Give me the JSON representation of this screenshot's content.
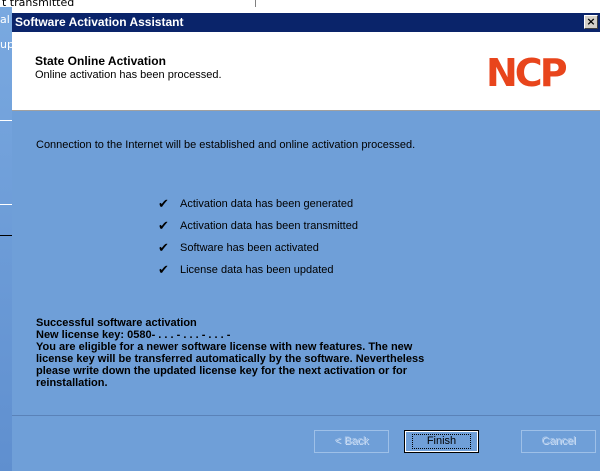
{
  "background": {
    "top_text": "t transmitted",
    "left_fragments": [
      "al",
      "up"
    ]
  },
  "dialog": {
    "title": "Software Activation Assistant",
    "close_label": "×"
  },
  "header": {
    "title": "State Online Activation",
    "subtitle": "Online activation has been processed.",
    "logo_text": "NCP",
    "logo_color": "#e8451c"
  },
  "body": {
    "intro": "Connection to the Internet will be established and online activation processed.",
    "checklist": [
      {
        "mark": "✔",
        "label": "Activation data has been generated"
      },
      {
        "mark": "✔",
        "label": "Activation data has been transmitted"
      },
      {
        "mark": "✔",
        "label": "Software has been activated"
      },
      {
        "mark": "✔",
        "label": "License data has been updated"
      }
    ]
  },
  "result": {
    "heading": "Successful software activation",
    "license_line": "New license key: 0580-  . . .  -  . . .  -  . . .  -",
    "message_lines": [
      "You are eligible for a newer software license with new features. The new",
      "license key will be transferred automatically by the software. Nevertheless",
      "please write down the updated license key for the next activation or for",
      "reinstallation."
    ]
  },
  "buttons": {
    "back": "< Back",
    "finish": "Finish",
    "cancel": "Cancel"
  },
  "colors": {
    "dialog_bg": "#6f9fd8",
    "titlebar": "#0a246a"
  }
}
